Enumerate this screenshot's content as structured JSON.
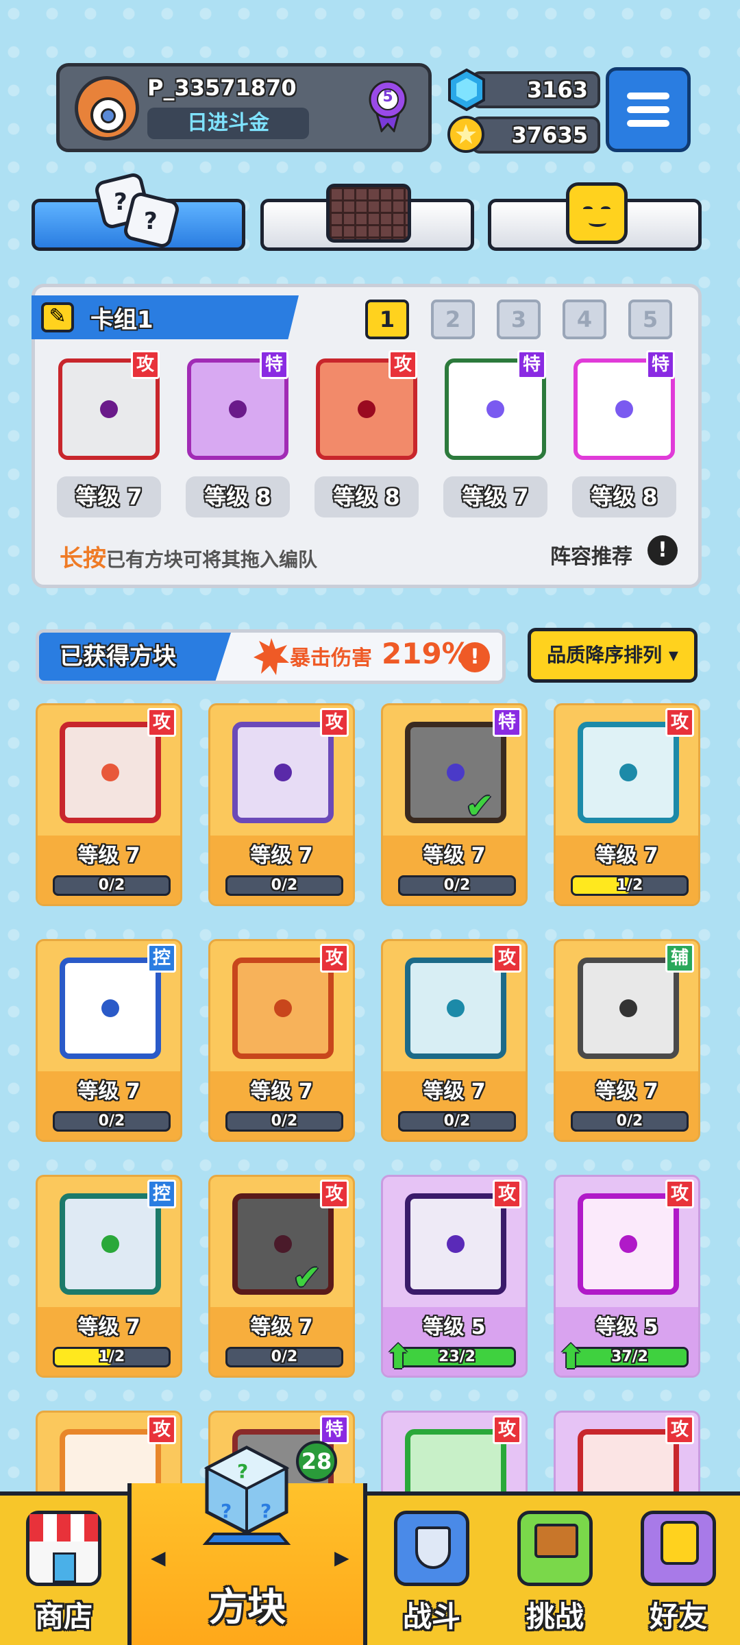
{
  "header": {
    "player_name": "P_33571870",
    "player_title": "日进斗金",
    "rank_level": "5",
    "gems": "3163",
    "coins": "37635"
  },
  "deck": {
    "title": "卡组1",
    "slots": [
      "1",
      "2",
      "3",
      "4",
      "5"
    ],
    "selected_slot": "1",
    "cards": [
      {
        "tag": "攻",
        "level": "等级 7",
        "border": "#c8262c",
        "bg": "#e9eaec",
        "core": "#6a1a8a"
      },
      {
        "tag": "特",
        "level": "等级 8",
        "border": "#a12bb5",
        "bg": "#d8a9f2",
        "core": "#6a1a8a"
      },
      {
        "tag": "攻",
        "level": "等级 8",
        "border": "#c8262c",
        "bg": "#f28a6a",
        "core": "#9a0a20"
      },
      {
        "tag": "特",
        "level": "等级 7",
        "border": "#2c7a3c",
        "bg": "#ffffff",
        "core": "#7a5af0"
      },
      {
        "tag": "特",
        "level": "等级 8",
        "border": "#e03bd8",
        "bg": "#ffffff",
        "core": "#7a5af0"
      }
    ],
    "hint_emph": "长按",
    "hint_rest": "已有方块可将其拖入编队",
    "recommend": "阵容推荐",
    "info_glyph": "!"
  },
  "obtained": {
    "title": "已获得方块",
    "crit_label": "暴击伤害",
    "crit_value": "219%",
    "info_glyph": "!",
    "sort_label": "品质降序排列 ▾",
    "cards": [
      {
        "tag": "攻",
        "level": "等级 7",
        "progress": "0/2",
        "fill": 0,
        "border": "#c8262c",
        "bg": "#f4e4e0",
        "core": "#e8583a",
        "equipped": false
      },
      {
        "tag": "攻",
        "level": "等级 7",
        "progress": "0/2",
        "fill": 0,
        "border": "#6b4ab8",
        "bg": "#e7dcf5",
        "core": "#5a2aa8",
        "equipped": false
      },
      {
        "tag": "特",
        "level": "等级 7",
        "progress": "0/2",
        "fill": 0,
        "border": "#3a2a20",
        "bg": "#7a7a7a",
        "core": "#4a3ac8",
        "equipped": true
      },
      {
        "tag": "攻",
        "level": "等级 7",
        "progress": "1/2",
        "fill": 0.5,
        "border": "#1c8aa8",
        "bg": "#dff2f6",
        "core": "#1c8aa8",
        "equipped": false
      },
      {
        "tag": "控",
        "level": "等级 7",
        "progress": "0/2",
        "fill": 0,
        "border": "#2a5ac8",
        "bg": "#ffffff",
        "core": "#2a5ac8",
        "equipped": false
      },
      {
        "tag": "攻",
        "level": "等级 7",
        "progress": "0/2",
        "fill": 0,
        "border": "#c8461c",
        "bg": "#f7b25a",
        "core": "#c8461c",
        "equipped": false
      },
      {
        "tag": "攻",
        "level": "等级 7",
        "progress": "0/2",
        "fill": 0,
        "border": "#1c6a88",
        "bg": "#d8eef4",
        "core": "#1c8aa8",
        "equipped": false
      },
      {
        "tag": "辅",
        "level": "等级 7",
        "progress": "0/2",
        "fill": 0,
        "border": "#4a4a4a",
        "bg": "#e8e8e8",
        "core": "#333333",
        "equipped": false
      },
      {
        "tag": "控",
        "level": "等级 7",
        "progress": "1/2",
        "fill": 0.5,
        "border": "#1c7a6a",
        "bg": "#dfeaf4",
        "core": "#2aa83a",
        "equipped": false
      },
      {
        "tag": "攻",
        "level": "等级 7",
        "progress": "0/2",
        "fill": 0,
        "border": "#5a1a1a",
        "bg": "#5a5a5a",
        "core": "#4a1a2a",
        "equipped": true
      },
      {
        "tag": "攻",
        "level": "等级 5",
        "progress": "23/2",
        "fill": 1,
        "border": "#3a1a6a",
        "bg": "#eeeaf6",
        "core": "#5a2ab8",
        "upgrade": true
      },
      {
        "tag": "攻",
        "level": "等级 5",
        "progress": "37/2",
        "fill": 1,
        "border": "#b01ac8",
        "bg": "#fbeafb",
        "core": "#b01ac8",
        "upgrade": true
      },
      {
        "tag": "攻",
        "border": "#e8862a",
        "bg": "#fdf1e4"
      },
      {
        "tag": "特",
        "border": "#8a2a2a",
        "bg": "#8a8a8a"
      },
      {
        "tag": "攻",
        "border": "#2aa83a",
        "bg": "#c8f0c8"
      },
      {
        "tag": "攻",
        "border": "#c8262c",
        "bg": "#fbe4e4"
      }
    ]
  },
  "nav": {
    "items": [
      "商店",
      "方块",
      "战斗",
      "挑战",
      "好友"
    ],
    "block_badge": "28",
    "left_arrow": "◀",
    "right_arrow": "▶"
  },
  "colors": {
    "accent": "#2a7de1",
    "gold": "#ffd21e",
    "attack": "#e8323a",
    "special": "#8a2be2",
    "control": "#2a7de1",
    "support": "#2aa85a"
  }
}
